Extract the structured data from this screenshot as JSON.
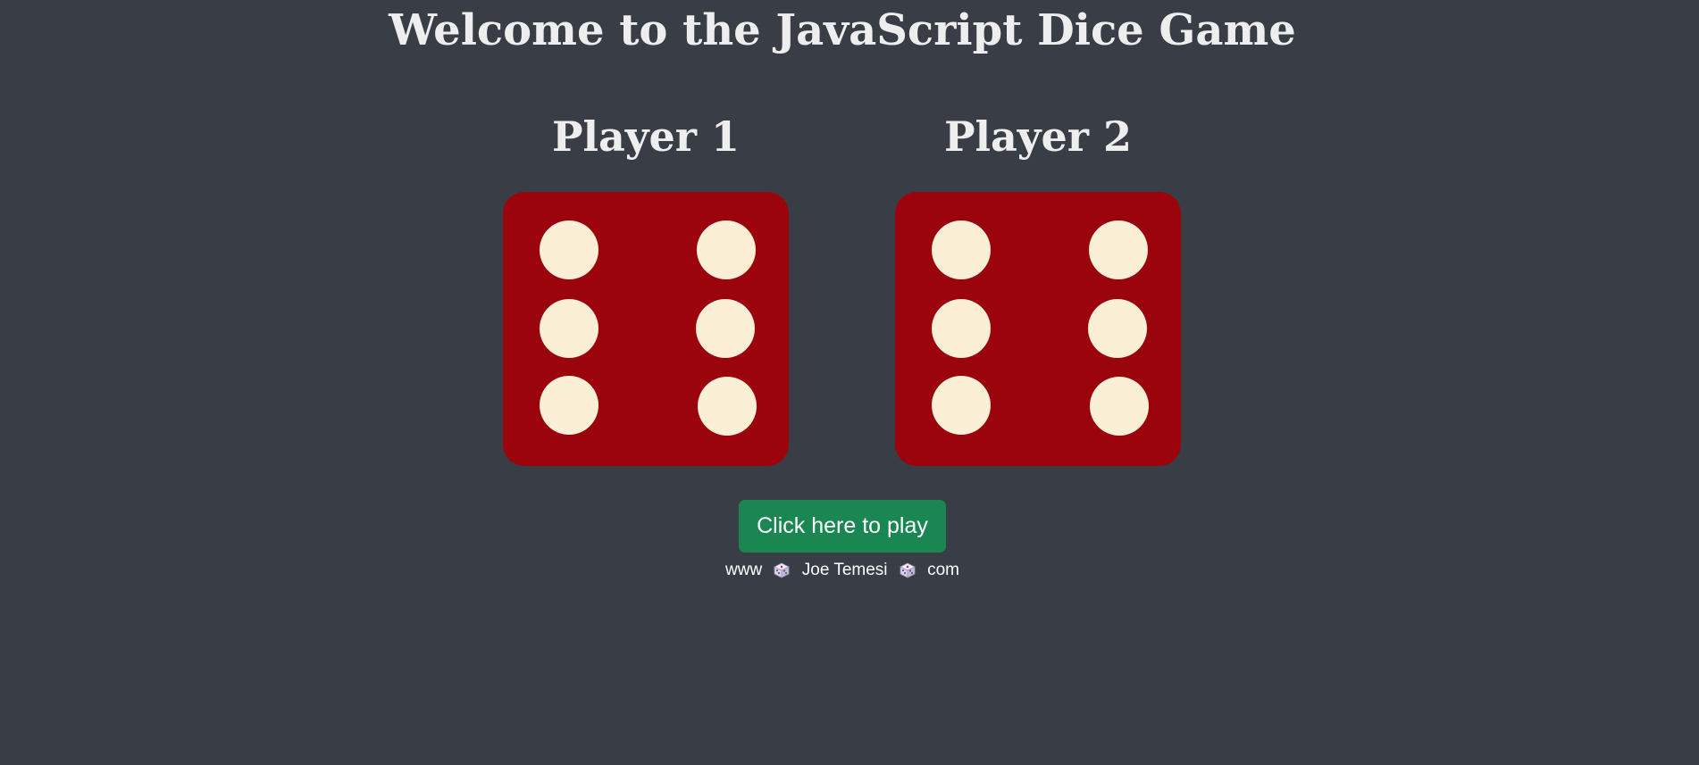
{
  "page": {
    "title": "Welcome to the JavaScript Dice Game"
  },
  "players": [
    {
      "label": "Player 1",
      "die_value": 6
    },
    {
      "label": "Player 2",
      "die_value": 6
    }
  ],
  "play_button": {
    "label": "Click here to play",
    "color": "#1a8753"
  },
  "footer": {
    "prefix": "www",
    "name": "Joe Temesi",
    "suffix": "com",
    "separator_icon": "die-icon"
  },
  "colors": {
    "background": "#393e46",
    "die": "#9b040d",
    "pip": "#fbf0d6",
    "text": "#eeeeee"
  }
}
